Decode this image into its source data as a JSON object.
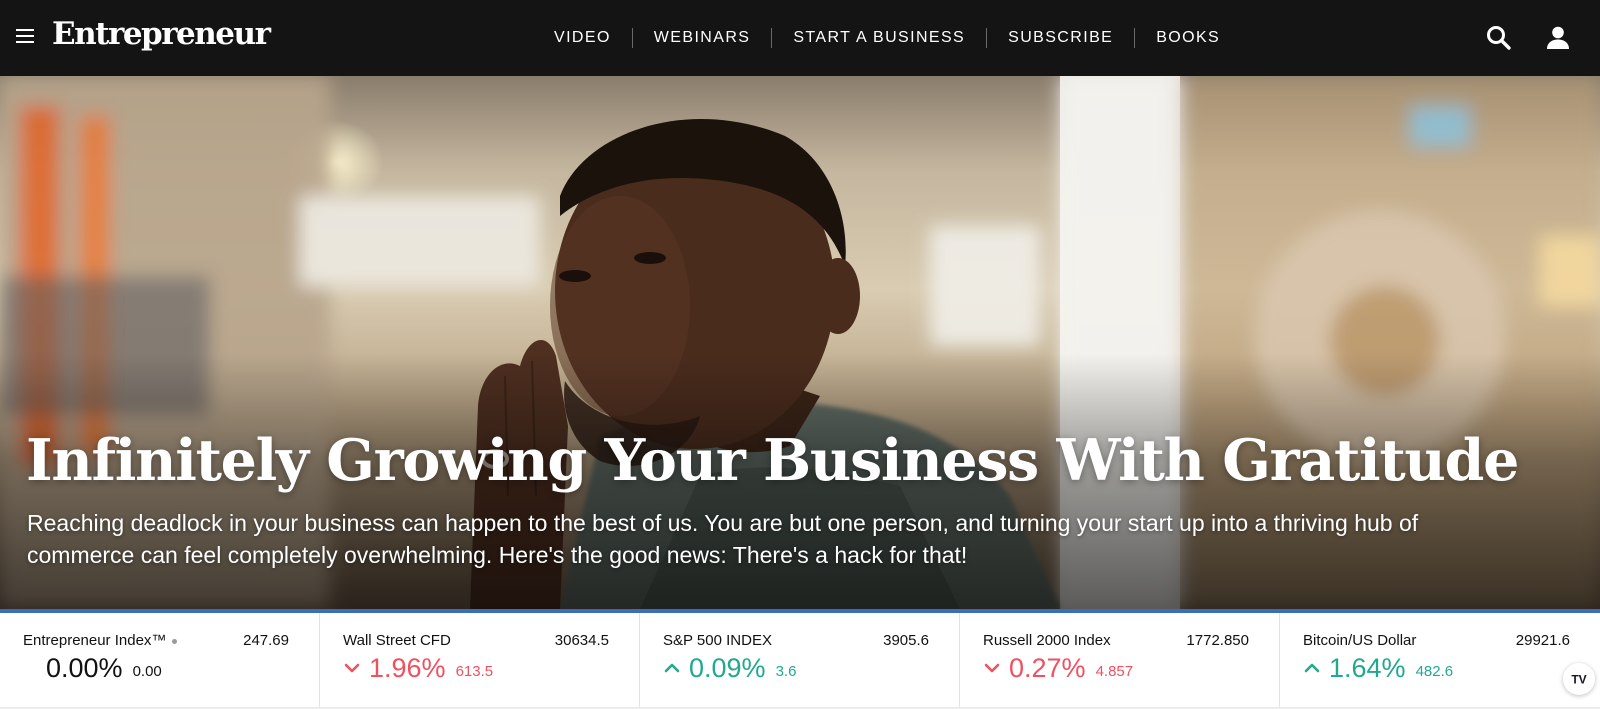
{
  "header": {
    "logo_text": "Entrepreneur",
    "nav": [
      "VIDEO",
      "WEBINARS",
      "START A BUSINESS",
      "SUBSCRIBE",
      "BOOKS"
    ],
    "icons": [
      "menu-icon",
      "search-icon",
      "user-icon"
    ]
  },
  "hero": {
    "title": "Infinitely Growing Your Business With Gratitude",
    "description": "Reaching deadlock in your business can happen to the best of us. You are but one person, and turning your start up into a thriving hub of commerce can feel completely overwhelming. Here's the good news: There's a hack for that!"
  },
  "ticker": {
    "items": [
      {
        "name": "Entrepreneur Index™",
        "price": "247.69",
        "change_pct": "0.00%",
        "change_abs": "0.00",
        "direction": "flat"
      },
      {
        "name": "Wall Street CFD",
        "price": "30634.5",
        "change_pct": "1.96%",
        "change_abs": "613.5",
        "direction": "down"
      },
      {
        "name": "S&P 500 INDEX",
        "price": "3905.6",
        "change_pct": "0.09%",
        "change_abs": "3.6",
        "direction": "up"
      },
      {
        "name": "Russell 2000 Index",
        "price": "1772.850",
        "change_pct": "0.27%",
        "change_abs": "4.857",
        "direction": "down"
      },
      {
        "name": "Bitcoin/US Dollar",
        "price": "29921.6",
        "change_pct": "1.64%",
        "change_abs": "482.6",
        "direction": "up"
      }
    ],
    "colors": {
      "up": "#22a88f",
      "down": "#ef5160",
      "accent_rule": "#3a6fb7"
    }
  },
  "widget": {
    "badge_text": "TV"
  }
}
